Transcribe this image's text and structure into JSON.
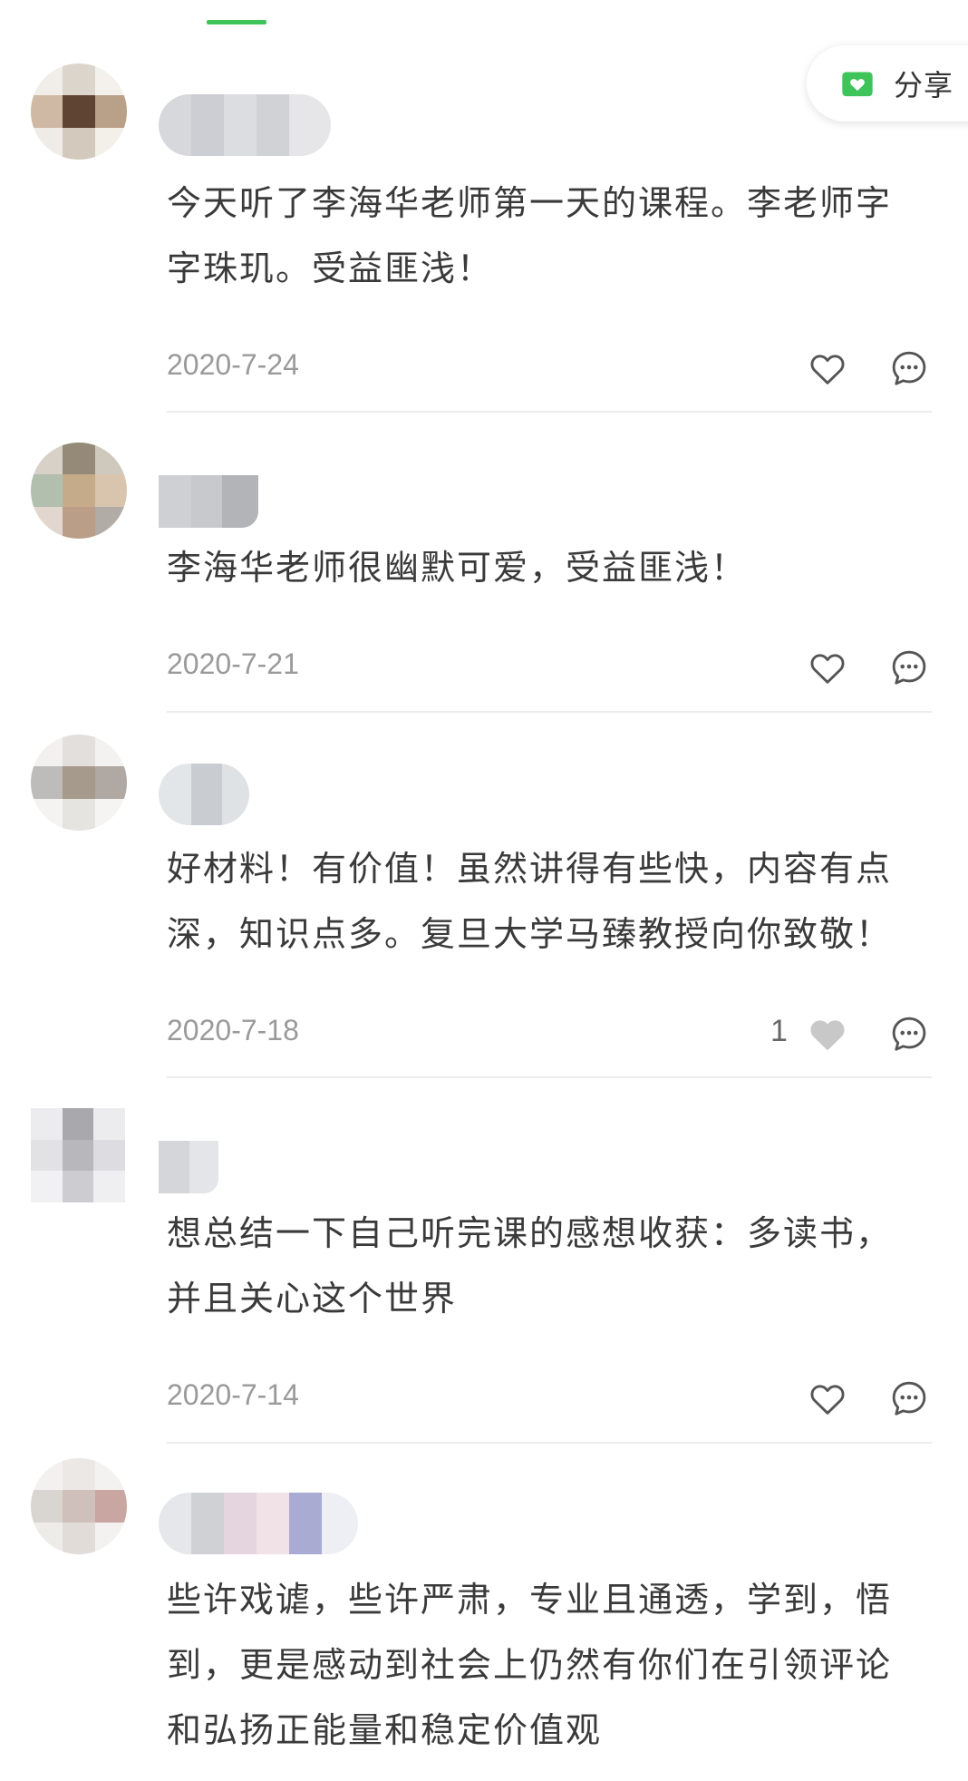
{
  "header": {
    "active_tab_indicator": "#3ec45a"
  },
  "share": {
    "label": "分享",
    "icon": "heart-envelope-icon",
    "icon_color": "#3ec45a"
  },
  "comments": [
    {
      "text": "今天听了李海华老师第一天的课程。李老师字字珠玑。受益匪浅！",
      "date": "2020-7-24",
      "like_count": "",
      "liked": false
    },
    {
      "text": "李海华老师很幽默可爱，受益匪浅！",
      "date": "2020-7-21",
      "like_count": "",
      "liked": false
    },
    {
      "text": "好材料！有价值！虽然讲得有些快，内容有点深，知识点多。复旦大学马臻教授向你致敬！",
      "date": "2020-7-18",
      "like_count": "1",
      "liked": true
    },
    {
      "text": "想总结一下自己听完课的感想收获：多读书，并且关心这个世界",
      "date": "2020-7-14",
      "like_count": "",
      "liked": false
    },
    {
      "text": "些许戏谑，些许严肃，专业且通透，学到，悟到，更是感动到社会上仍然有你们在引领评论和弘扬正能量和稳定价值观",
      "date": "",
      "like_count": "",
      "liked": false
    }
  ],
  "icons": {
    "like": "heart-outline-icon",
    "liked": "heart-filled-icon",
    "reply": "comment-bubble-icon"
  }
}
